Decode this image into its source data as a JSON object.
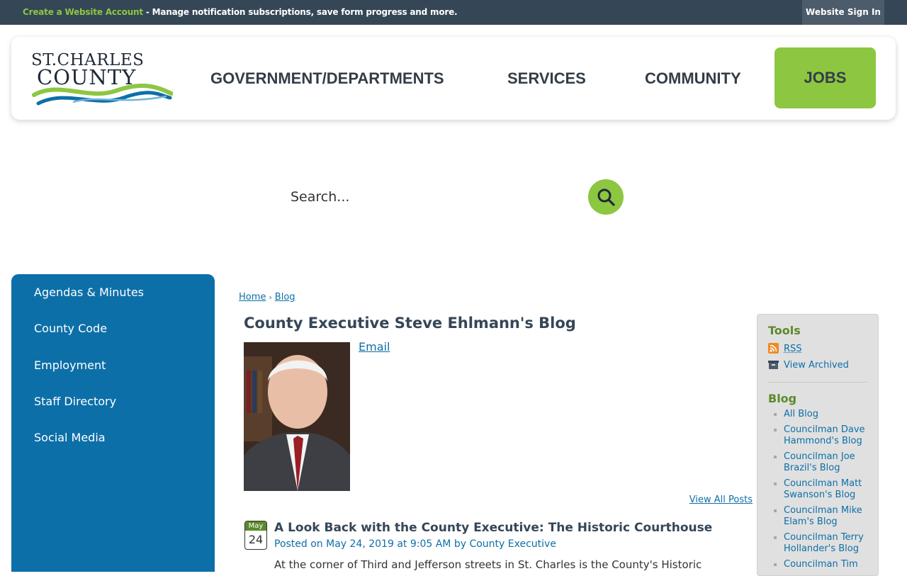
{
  "topbar": {
    "create_link": "Create a Website Account",
    "message": " - Manage notification subscriptions, save form progress and more.",
    "signin": "Website Sign In"
  },
  "logo": {
    "line1": "ST.CHARLES",
    "line2": "COUNTY"
  },
  "nav": {
    "items": [
      "GOVERNMENT/DEPARTMENTS",
      "SERVICES",
      "COMMUNITY"
    ],
    "jobs": "JOBS"
  },
  "search": {
    "placeholder": "Search..."
  },
  "sidebar": {
    "items": [
      "Agendas & Minutes",
      "County Code",
      "Employment",
      "Staff Directory",
      "Social Media"
    ]
  },
  "breadcrumb": {
    "home": "Home",
    "separator": "›",
    "blog": "Blog"
  },
  "main": {
    "title": "County Executive Steve Ehlmann's Blog",
    "email": "Email",
    "view_all": "View All Posts"
  },
  "post": {
    "month": "May",
    "day": "24",
    "title": "A Look Back with the County Executive: The Historic Courthouse",
    "meta": "Posted on May 24, 2019 at 9:05 AM by County Executive",
    "excerpt": "At the corner of Third and Jefferson streets in St. Charles is the County's Historic"
  },
  "tools": {
    "heading": "Tools",
    "rss": "RSS",
    "archived": "View Archived",
    "blog_heading": "Blog",
    "blog_items": [
      "All Blog",
      "Councilman Dave Hammond's Blog",
      "Councilman Joe Brazil's Blog",
      "Councilman Matt Swanson's Blog",
      "Councilman Mike Elam's Blog",
      "Councilman Terry Hollander's Blog",
      "Councilman Tim"
    ]
  },
  "colors": {
    "topbar": "#354657",
    "accent_green": "#8dc641",
    "sidebar_blue": "#0d6fa8",
    "heading_dark": "#354657"
  }
}
